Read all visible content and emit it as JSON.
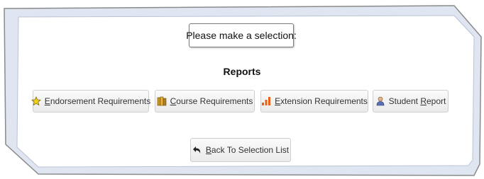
{
  "prompt": {
    "text": "Please make a selection:"
  },
  "reports": {
    "title": "Reports",
    "buttons": [
      {
        "accel": "E",
        "rest": "ndorsement Requirements",
        "icon": "star-icon"
      },
      {
        "accel": "C",
        "rest": "ourse Requirements",
        "icon": "books-icon"
      },
      {
        "accel": "E",
        "rest": "xtension Requirements",
        "icon": "bar-chart-icon"
      },
      {
        "pre": "Student ",
        "accel": "R",
        "rest": "eport",
        "icon": "user-icon"
      }
    ]
  },
  "back": {
    "accel": "B",
    "rest": "ack To Selection List",
    "icon": "back-arrow-icon"
  },
  "colors": {
    "frame_fill": "#dfe6f2",
    "frame_border": "#8a8a8a",
    "button_border": "#cfcfcf"
  }
}
